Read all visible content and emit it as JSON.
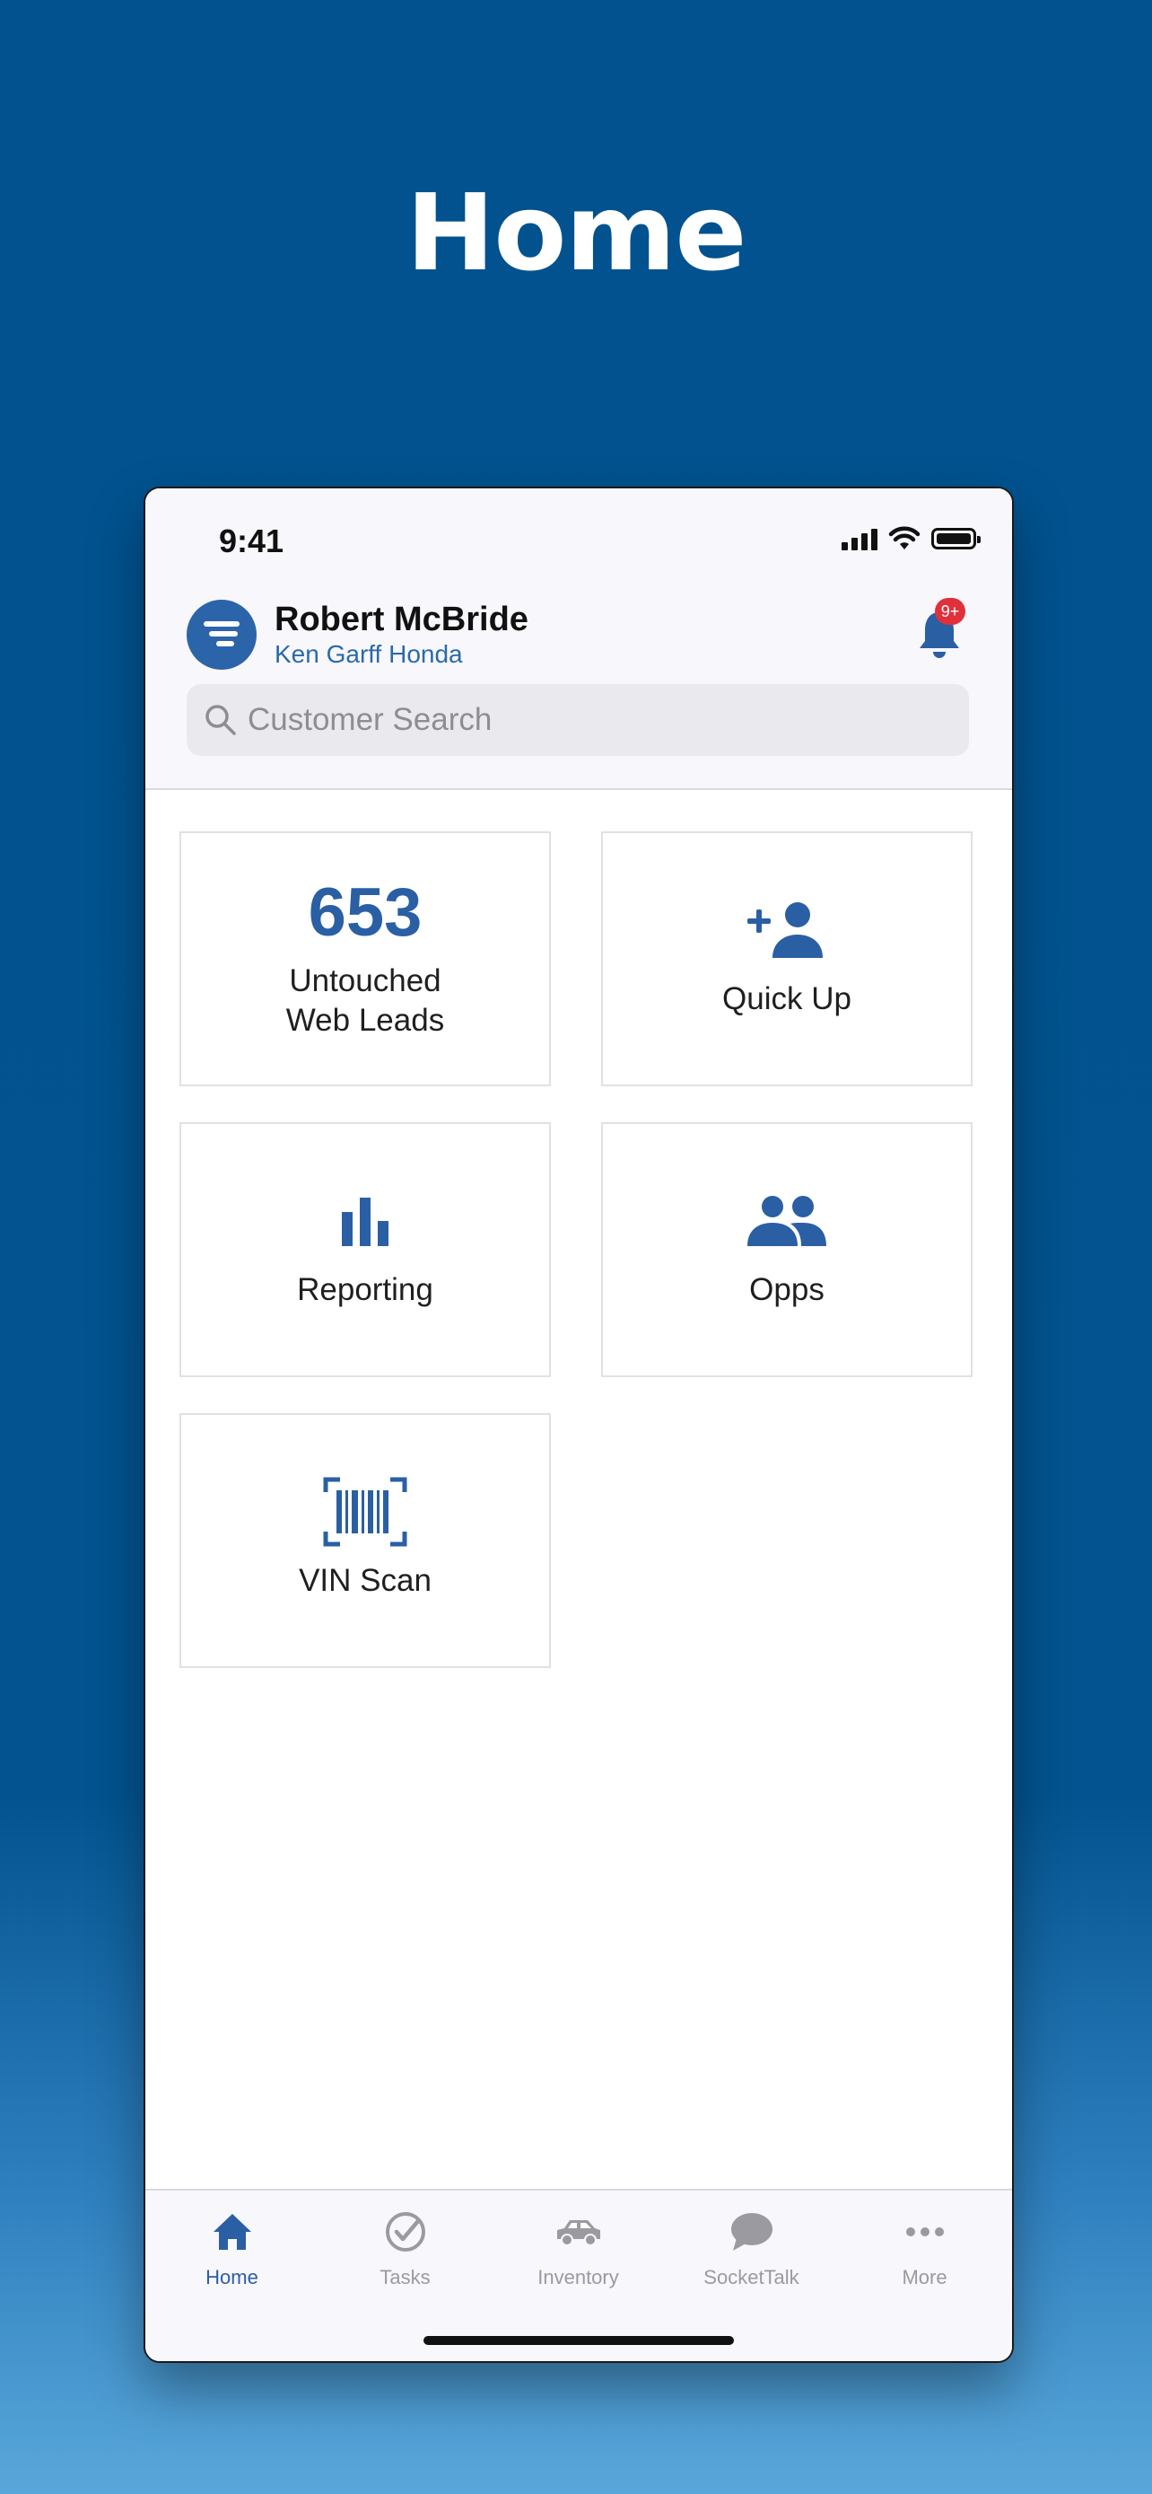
{
  "page": {
    "heading": "Home"
  },
  "status_bar": {
    "time": "9:41"
  },
  "header": {
    "user_name": "Robert McBride",
    "dealer_name": "Ken Garff Honda",
    "notification_badge": "9+",
    "search_placeholder": "Customer Search"
  },
  "tiles": [
    {
      "number": "653",
      "label": "Untouched\nWeb Leads",
      "icon": "none"
    },
    {
      "label": "Quick Up",
      "icon": "add-person-icon"
    },
    {
      "label": "Reporting",
      "icon": "bar-chart-icon"
    },
    {
      "label": "Opps",
      "icon": "people-icon"
    },
    {
      "label": "VIN Scan",
      "icon": "barcode-scan-icon"
    }
  ],
  "tabbar": {
    "items": [
      {
        "label": "Home",
        "icon": "home-icon",
        "active": true
      },
      {
        "label": "Tasks",
        "icon": "check-circle-icon",
        "active": false
      },
      {
        "label": "Inventory",
        "icon": "car-icon",
        "active": false
      },
      {
        "label": "SocketTalk",
        "icon": "chat-bubble-icon",
        "active": false
      },
      {
        "label": "More",
        "icon": "more-dots-icon",
        "active": false
      }
    ]
  },
  "colors": {
    "background_blue": "#01528f",
    "accent_blue": "#2a5fa4",
    "badge_red": "#e0303a",
    "inactive_gray": "#9a9aa0"
  }
}
